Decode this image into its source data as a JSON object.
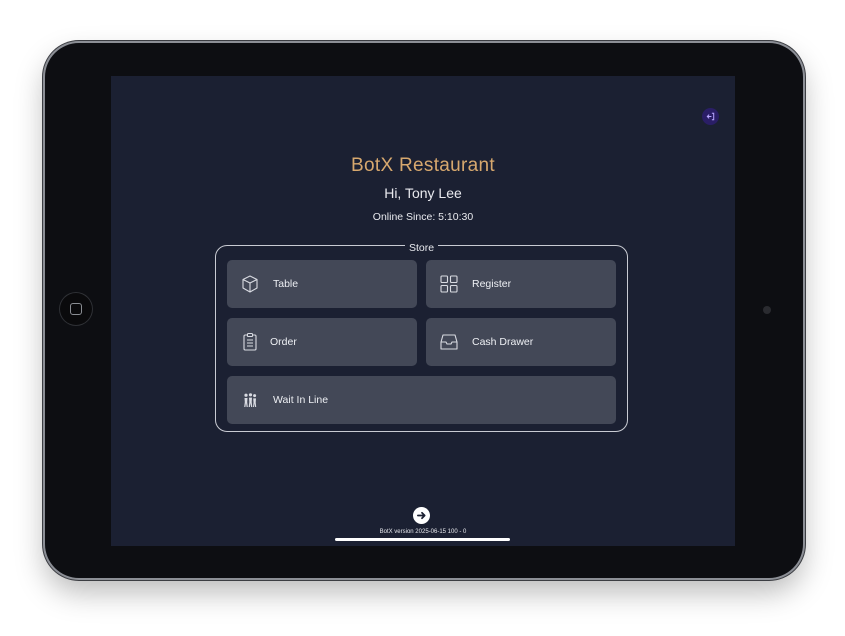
{
  "app": {
    "title": "BotX Restaurant",
    "greeting": "Hi, Tony Lee",
    "online_label": "Online Since:",
    "online_value": "5:10:30"
  },
  "store": {
    "label": "Store",
    "tiles": [
      {
        "label": "Table",
        "icon": "cube-icon"
      },
      {
        "label": "Register",
        "icon": "grid-icon"
      },
      {
        "label": "Order",
        "icon": "clipboard-icon"
      },
      {
        "label": "Cash Drawer",
        "icon": "inbox-tray-icon"
      },
      {
        "label": "Wait In Line",
        "icon": "people-queue-icon"
      }
    ]
  },
  "footer": {
    "version": "BotX version 2025-06-15 100 - 0",
    "next_icon": "arrow-right-circle-icon"
  },
  "colors": {
    "screen_bg": "#1b2032",
    "title_accent": "#d7a86e",
    "tile_bg": "#434857",
    "logout_bg": "#2a1e66"
  }
}
